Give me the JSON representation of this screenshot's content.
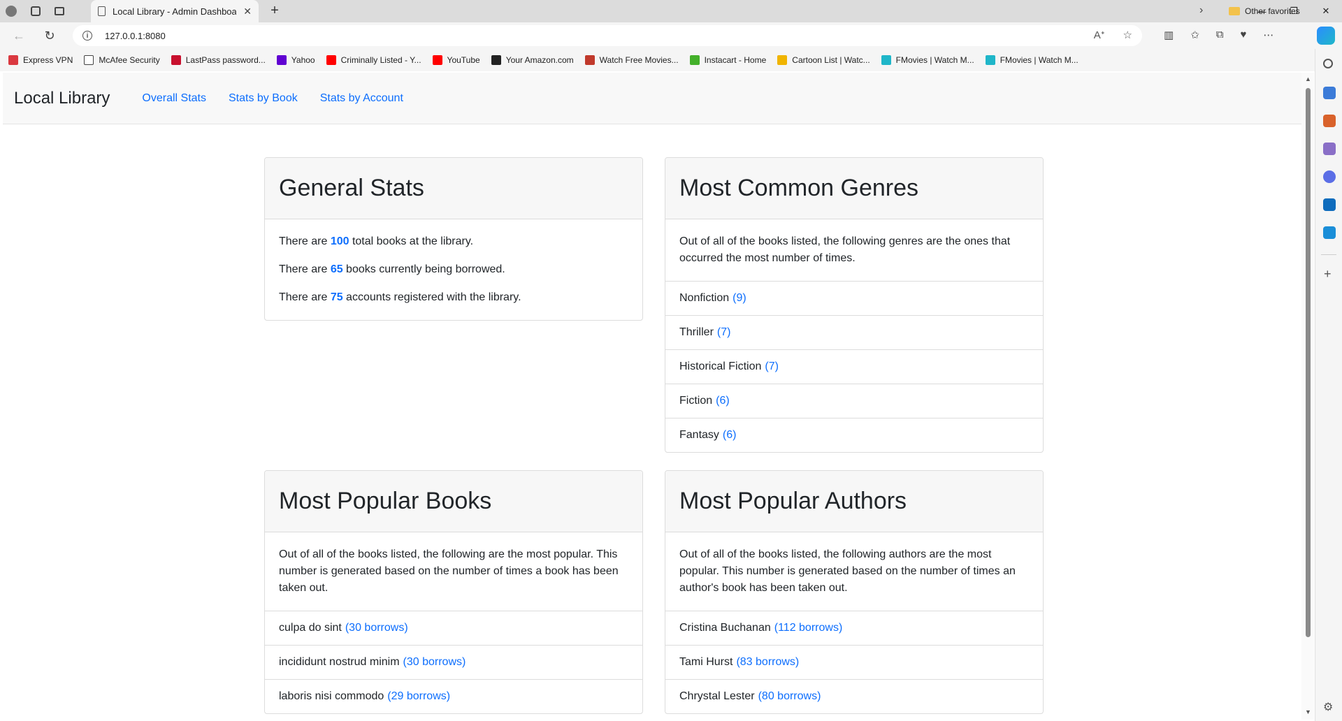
{
  "browser": {
    "tab_title": "Local Library - Admin Dashboard",
    "url": "127.0.0.1:8080",
    "bookmarks": [
      {
        "label": "Express VPN",
        "color": "#da3940"
      },
      {
        "label": "McAfee Security",
        "color": "#ffffff"
      },
      {
        "label": "LastPass password...",
        "color": "#c8102e"
      },
      {
        "label": "Yahoo",
        "color": "#6001d2"
      },
      {
        "label": "Criminally Listed - Y...",
        "color": "#ff0000"
      },
      {
        "label": "YouTube",
        "color": "#ff0000"
      },
      {
        "label": "Your Amazon.com",
        "color": "#222222"
      },
      {
        "label": "Watch Free Movies...",
        "color": "#c0392b"
      },
      {
        "label": "Instacart - Home",
        "color": "#43b02a"
      },
      {
        "label": "Cartoon List | Watc...",
        "color": "#f0b400"
      },
      {
        "label": "FMovies | Watch M...",
        "color": "#1fb6c9"
      },
      {
        "label": "FMovies | Watch M...",
        "color": "#1fb6c9"
      }
    ],
    "other_favorites": "Other favorites"
  },
  "navbar": {
    "brand": "Local Library",
    "links": [
      "Overall Stats",
      "Stats by Book",
      "Stats by Account"
    ]
  },
  "general_stats": {
    "title": "General Stats",
    "lines": [
      {
        "pre": "There are ",
        "num": "100",
        "post": " total books at the library."
      },
      {
        "pre": "There are ",
        "num": "65",
        "post": " books currently being borrowed."
      },
      {
        "pre": "There are ",
        "num": "75",
        "post": " accounts registered with the library."
      }
    ]
  },
  "genres": {
    "title": "Most Common Genres",
    "intro": "Out of all of the books listed, the following genres are the ones that occurred the most number of times.",
    "items": [
      {
        "name": "Nonfiction",
        "count": "(9)"
      },
      {
        "name": "Thriller",
        "count": "(7)"
      },
      {
        "name": "Historical Fiction",
        "count": "(7)"
      },
      {
        "name": "Fiction",
        "count": "(6)"
      },
      {
        "name": "Fantasy",
        "count": "(6)"
      }
    ]
  },
  "books": {
    "title": "Most Popular Books",
    "intro": "Out of all of the books listed, the following are the most popular. This number is generated based on the number of times a book has been taken out.",
    "items": [
      {
        "name": "culpa do sint",
        "count": "(30 borrows)"
      },
      {
        "name": "incididunt nostrud minim",
        "count": "(30 borrows)"
      },
      {
        "name": "laboris nisi commodo",
        "count": "(29 borrows)"
      }
    ]
  },
  "authors": {
    "title": "Most Popular Authors",
    "intro": "Out of all of the books listed, the following authors are the most popular. This number is generated based on the number of times an author's book has been taken out.",
    "items": [
      {
        "name": "Cristina Buchanan",
        "count": "(112 borrows)"
      },
      {
        "name": "Tami Hurst",
        "count": "(83 borrows)"
      },
      {
        "name": "Chrystal Lester",
        "count": "(80 borrows)"
      }
    ]
  }
}
